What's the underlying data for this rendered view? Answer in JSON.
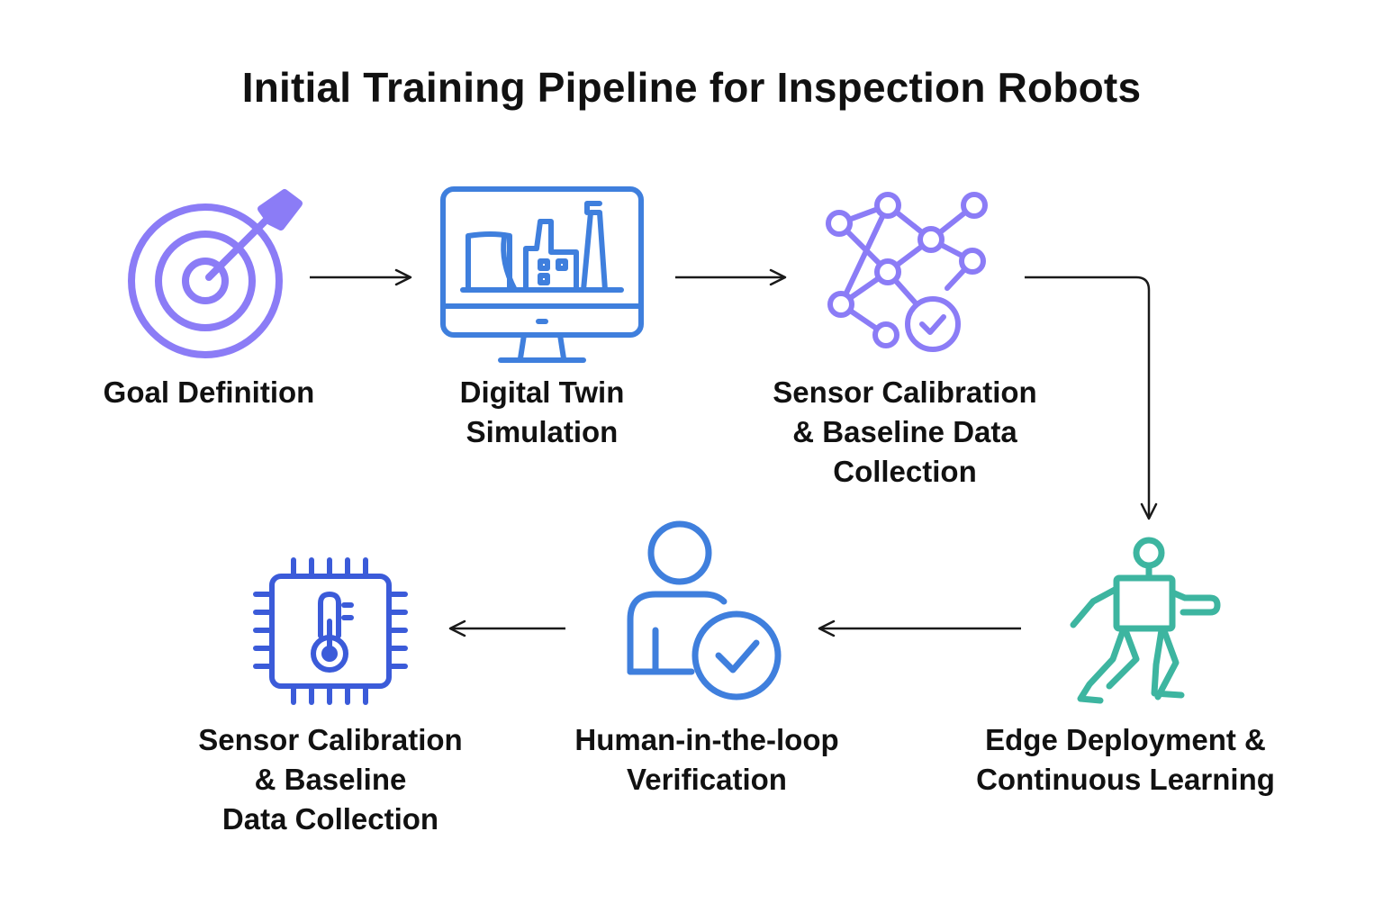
{
  "title": "Initial Training Pipeline for Inspection Robots",
  "colors": {
    "purple": "#8b7cf6",
    "blue": "#3f7fdd",
    "indigo": "#3b5bd9",
    "teal": "#3db5a0",
    "arrow": "#1a1a1a"
  },
  "steps": [
    {
      "icon": "target-icon",
      "lines": [
        "Goal Definition"
      ]
    },
    {
      "icon": "monitor-factory-icon",
      "lines": [
        "Digital Twin",
        "Simulation"
      ]
    },
    {
      "icon": "network-check-icon",
      "lines": [
        "Sensor Calibration",
        "& Baseline Data",
        "Collection"
      ]
    },
    {
      "icon": "robot-icon",
      "lines": [
        "Edge Deployment &",
        "Continuous Learning"
      ]
    },
    {
      "icon": "user-check-icon",
      "lines": [
        "Human-in-the-loop",
        "Verification"
      ]
    },
    {
      "icon": "chip-thermometer-icon",
      "lines": [
        "Sensor Calibration",
        "& Baseline",
        "Data Collection"
      ]
    }
  ]
}
